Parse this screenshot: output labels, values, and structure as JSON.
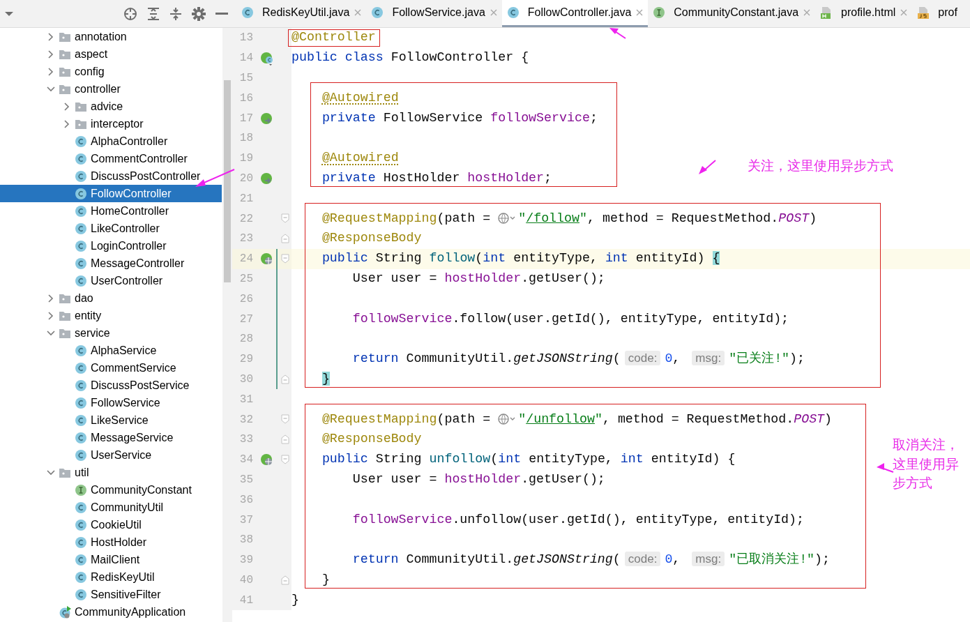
{
  "tabs": [
    {
      "label": "RedisKeyUtil.java",
      "kind": "class",
      "selected": false,
      "closable": true
    },
    {
      "label": "FollowService.java",
      "kind": "class",
      "selected": false,
      "closable": true
    },
    {
      "label": "FollowController.java",
      "kind": "class",
      "selected": true,
      "closable": true
    },
    {
      "label": "CommunityConstant.java",
      "kind": "interface",
      "selected": false,
      "closable": true
    },
    {
      "label": "profile.html",
      "kind": "html",
      "selected": false,
      "closable": true
    },
    {
      "label": "prof",
      "kind": "js",
      "selected": false,
      "closable": false
    }
  ],
  "project_tree": {
    "items": [
      {
        "label": "annotation",
        "kind": "folder",
        "expanded": false,
        "selected": false
      },
      {
        "label": "aspect",
        "kind": "folder",
        "expanded": false,
        "selected": false
      },
      {
        "label": "config",
        "kind": "folder",
        "expanded": false,
        "selected": false
      },
      {
        "label": "controller",
        "kind": "folder",
        "expanded": true,
        "selected": false,
        "children": [
          {
            "label": "advice",
            "kind": "folder",
            "expanded": false,
            "selected": false
          },
          {
            "label": "interceptor",
            "kind": "folder",
            "expanded": false,
            "selected": false
          },
          {
            "label": "AlphaController",
            "kind": "class",
            "selected": false
          },
          {
            "label": "CommentController",
            "kind": "class",
            "selected": false
          },
          {
            "label": "DiscussPostController",
            "kind": "class",
            "selected": false
          },
          {
            "label": "FollowController",
            "kind": "class",
            "selected": true
          },
          {
            "label": "HomeController",
            "kind": "class",
            "selected": false
          },
          {
            "label": "LikeController",
            "kind": "class",
            "selected": false
          },
          {
            "label": "LoginController",
            "kind": "class",
            "selected": false
          },
          {
            "label": "MessageController",
            "kind": "class",
            "selected": false
          },
          {
            "label": "UserController",
            "kind": "class",
            "selected": false
          }
        ]
      },
      {
        "label": "dao",
        "kind": "folder",
        "expanded": false,
        "selected": false
      },
      {
        "label": "entity",
        "kind": "folder",
        "expanded": false,
        "selected": false
      },
      {
        "label": "service",
        "kind": "folder",
        "expanded": true,
        "selected": false,
        "children": [
          {
            "label": "AlphaService",
            "kind": "class",
            "selected": false
          },
          {
            "label": "CommentService",
            "kind": "class",
            "selected": false
          },
          {
            "label": "DiscussPostService",
            "kind": "class",
            "selected": false
          },
          {
            "label": "FollowService",
            "kind": "class",
            "selected": false
          },
          {
            "label": "LikeService",
            "kind": "class",
            "selected": false
          },
          {
            "label": "MessageService",
            "kind": "class",
            "selected": false
          },
          {
            "label": "UserService",
            "kind": "class",
            "selected": false
          }
        ]
      },
      {
        "label": "util",
        "kind": "folder",
        "expanded": true,
        "selected": false,
        "children": [
          {
            "label": "CommunityConstant",
            "kind": "interface",
            "selected": false
          },
          {
            "label": "CommunityUtil",
            "kind": "class",
            "selected": false
          },
          {
            "label": "CookieUtil",
            "kind": "class",
            "selected": false
          },
          {
            "label": "HostHolder",
            "kind": "class",
            "selected": false
          },
          {
            "label": "MailClient",
            "kind": "class",
            "selected": false
          },
          {
            "label": "RedisKeyUtil",
            "kind": "class",
            "selected": false
          },
          {
            "label": "SensitiveFilter",
            "kind": "class",
            "selected": false
          }
        ]
      },
      {
        "label": "CommunityApplication",
        "kind": "application",
        "selected": false
      }
    ]
  },
  "editor": {
    "blocks": [
      {
        "boxed": true,
        "lines": [
          {
            "number": "13",
            "current": false,
            "changed": false,
            "tokens": [
              {
                "kind": "annotation",
                "text": "@Controller"
              }
            ]
          }
        ]
      },
      {
        "boxed": false,
        "lines": [
          {
            "number": "14",
            "gutter_icon": {
              "kind": "bean"
            },
            "current": false,
            "changed": false,
            "tokens": [
              {
                "kind": "keyword",
                "text": "public"
              },
              {
                "kind": "keyword",
                "text": " class"
              },
              {
                "kind": "plain",
                "text": " FollowController {"
              }
            ]
          },
          {
            "number": "15",
            "current": false,
            "changed": false
          }
        ]
      },
      {
        "boxed": true,
        "lines": [
          {
            "number": "16",
            "current": false,
            "changed": false,
            "tokens": [
              {
                "kind": "annotation-warn",
                "text": "    @Autowired"
              }
            ]
          },
          {
            "number": "17",
            "gutter_icon": {
              "kind": "inject"
            },
            "current": false,
            "changed": false,
            "tokens": [
              {
                "kind": "keyword",
                "text": "    private"
              },
              {
                "kind": "plain",
                "text": " FollowService "
              },
              {
                "kind": "field",
                "text": "followService"
              },
              {
                "kind": "plain",
                "text": ";"
              }
            ]
          },
          {
            "number": "18",
            "current": false,
            "changed": false
          },
          {
            "number": "19",
            "current": false,
            "changed": false,
            "tokens": [
              {
                "kind": "annotation-warn",
                "text": "    @Autowired"
              }
            ]
          },
          {
            "number": "20",
            "gutter_icon": {
              "kind": "inject"
            },
            "current": false,
            "changed": false,
            "tokens": [
              {
                "kind": "keyword",
                "text": "    private"
              },
              {
                "kind": "plain",
                "text": " HostHolder "
              },
              {
                "kind": "field",
                "text": "hostHolder"
              },
              {
                "kind": "plain",
                "text": ";"
              }
            ]
          }
        ]
      },
      {
        "boxed": false,
        "lines": [
          {
            "number": "21",
            "current": false,
            "changed": false
          }
        ]
      },
      {
        "boxed": true,
        "lines": [
          {
            "number": "22",
            "fold": {
              "kind": "start"
            },
            "current": false,
            "changed": false,
            "tokens": [
              {
                "kind": "annotation",
                "text": "    @RequestMapping"
              },
              {
                "kind": "plain",
                "text": "(path = "
              },
              {
                "kind": "url-icon"
              },
              {
                "kind": "string",
                "text": "\""
              },
              {
                "kind": "link",
                "text": "/follow"
              },
              {
                "kind": "string",
                "text": "\""
              },
              {
                "kind": "plain",
                "text": ", method = RequestMethod."
              },
              {
                "kind": "constant",
                "text": "POST"
              },
              {
                "kind": "plain",
                "text": ")"
              }
            ]
          },
          {
            "number": "23",
            "fold": {
              "kind": "end"
            },
            "current": false,
            "changed": false,
            "tokens": [
              {
                "kind": "annotation",
                "text": "    @ResponseBody"
              }
            ]
          },
          {
            "number": "24",
            "gutter_icon": {
              "kind": "web"
            },
            "fold": {
              "kind": "start"
            },
            "current": true,
            "changed": true,
            "tokens": [
              {
                "kind": "keyword",
                "text": "    public"
              },
              {
                "kind": "plain",
                "text": " String "
              },
              {
                "kind": "method",
                "text": "follow"
              },
              {
                "kind": "plain",
                "text": "("
              },
              {
                "kind": "keyword",
                "text": "int"
              },
              {
                "kind": "plain",
                "text": " entityType, "
              },
              {
                "kind": "keyword",
                "text": "int"
              },
              {
                "kind": "plain",
                "text": " entityId) "
              },
              {
                "kind": "brace-match",
                "text": "{"
              }
            ]
          },
          {
            "number": "25",
            "current": false,
            "changed": true,
            "tokens": [
              {
                "kind": "plain",
                "text": "        User user = "
              },
              {
                "kind": "field",
                "text": "hostHolder"
              },
              {
                "kind": "plain",
                "text": ".getUser();"
              }
            ]
          },
          {
            "number": "26",
            "current": false,
            "changed": true
          },
          {
            "number": "27",
            "current": false,
            "changed": true,
            "tokens": [
              {
                "kind": "field",
                "text": "        followService"
              },
              {
                "kind": "plain",
                "text": ".follow(user.getId(), entityType, entityId);"
              }
            ]
          },
          {
            "number": "28",
            "current": false,
            "changed": true
          },
          {
            "number": "29",
            "current": false,
            "changed": true,
            "tokens": [
              {
                "kind": "keyword",
                "text": "        return"
              },
              {
                "kind": "plain",
                "text": " CommunityUtil."
              },
              {
                "kind": "static",
                "text": "getJSONString"
              },
              {
                "kind": "plain",
                "text": "("
              },
              {
                "kind": "hint",
                "text": "code:"
              },
              {
                "kind": "number",
                "text": "0"
              },
              {
                "kind": "plain",
                "text": ", "
              },
              {
                "kind": "hint",
                "text": "msg:"
              },
              {
                "kind": "string",
                "text": "\"已关注!\""
              },
              {
                "kind": "plain",
                "text": ");"
              }
            ]
          },
          {
            "number": "30",
            "fold": {
              "kind": "end"
            },
            "current": false,
            "changed": true,
            "tokens": [
              {
                "kind": "brace-match",
                "text": "    }"
              }
            ]
          }
        ]
      },
      {
        "boxed": false,
        "lines": [
          {
            "number": "31",
            "current": false,
            "changed": false
          }
        ]
      },
      {
        "boxed": true,
        "lines": [
          {
            "number": "32",
            "fold": {
              "kind": "start"
            },
            "current": false,
            "changed": false,
            "tokens": [
              {
                "kind": "annotation",
                "text": "    @RequestMapping"
              },
              {
                "kind": "plain",
                "text": "(path = "
              },
              {
                "kind": "url-icon"
              },
              {
                "kind": "string",
                "text": "\""
              },
              {
                "kind": "link",
                "text": "/unfollow"
              },
              {
                "kind": "string",
                "text": "\""
              },
              {
                "kind": "plain",
                "text": ", method = RequestMethod."
              },
              {
                "kind": "constant",
                "text": "POST"
              },
              {
                "kind": "plain",
                "text": ")"
              }
            ]
          },
          {
            "number": "33",
            "fold": {
              "kind": "end"
            },
            "current": false,
            "changed": false,
            "tokens": [
              {
                "kind": "annotation",
                "text": "    @ResponseBody"
              }
            ]
          },
          {
            "number": "34",
            "gutter_icon": {
              "kind": "web"
            },
            "fold": {
              "kind": "start"
            },
            "current": false,
            "changed": false,
            "tokens": [
              {
                "kind": "keyword",
                "text": "    public"
              },
              {
                "kind": "plain",
                "text": " String "
              },
              {
                "kind": "method",
                "text": "unfollow"
              },
              {
                "kind": "plain",
                "text": "("
              },
              {
                "kind": "keyword",
                "text": "int"
              },
              {
                "kind": "plain",
                "text": " entityType, "
              },
              {
                "kind": "keyword",
                "text": "int"
              },
              {
                "kind": "plain",
                "text": " entityId) {"
              }
            ]
          },
          {
            "number": "35",
            "current": false,
            "changed": false,
            "tokens": [
              {
                "kind": "plain",
                "text": "        User user = "
              },
              {
                "kind": "field",
                "text": "hostHolder"
              },
              {
                "kind": "plain",
                "text": ".getUser();"
              }
            ]
          },
          {
            "number": "36",
            "current": false,
            "changed": false
          },
          {
            "number": "37",
            "current": false,
            "changed": false,
            "tokens": [
              {
                "kind": "field",
                "text": "        followService"
              },
              {
                "kind": "plain",
                "text": ".unfollow(user.getId(), entityType, entityId);"
              }
            ]
          },
          {
            "number": "38",
            "current": false,
            "changed": false
          },
          {
            "number": "39",
            "current": false,
            "changed": false,
            "tokens": [
              {
                "kind": "keyword",
                "text": "        return"
              },
              {
                "kind": "plain",
                "text": " CommunityUtil."
              },
              {
                "kind": "static",
                "text": "getJSONString"
              },
              {
                "kind": "plain",
                "text": "("
              },
              {
                "kind": "hint",
                "text": "code:"
              },
              {
                "kind": "number",
                "text": "0"
              },
              {
                "kind": "plain",
                "text": ", "
              },
              {
                "kind": "hint",
                "text": "msg:"
              },
              {
                "kind": "string",
                "text": "\"已取消关注!\""
              },
              {
                "kind": "plain",
                "text": ");"
              }
            ]
          },
          {
            "number": "40",
            "fold": {
              "kind": "end"
            },
            "current": false,
            "changed": false,
            "tokens": [
              {
                "kind": "plain",
                "text": "    }"
              }
            ]
          }
        ]
      },
      {
        "boxed": false,
        "lines": [
          {
            "number": "41",
            "current": false,
            "changed": false,
            "tokens": [
              {
                "kind": "plain",
                "text": "}"
              }
            ]
          }
        ]
      }
    ]
  },
  "callouts": [
    {
      "text": "关注，这里使用异步方式"
    },
    {
      "text": "取消关注，这里使用异步方式"
    }
  ]
}
